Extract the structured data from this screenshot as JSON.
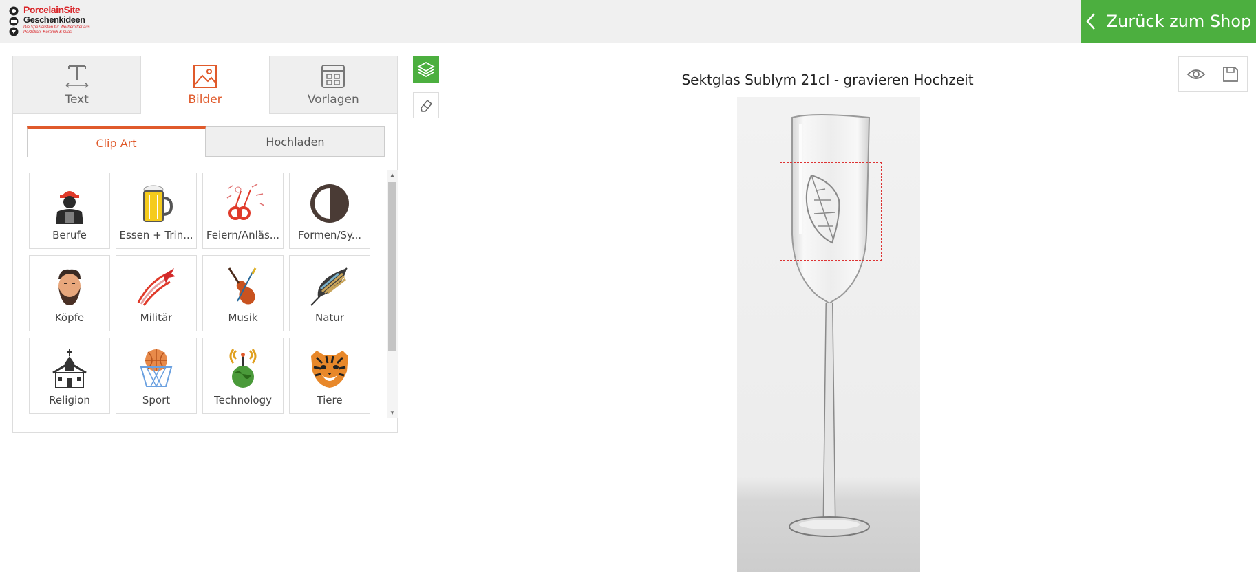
{
  "header": {
    "logo": {
      "line1": "PorcelainSite",
      "line2": "Geschenkideen",
      "tagline": "Die Spezialisten für Werbemittel aus Porzellan, Keramik & Glas"
    },
    "back_label": "Zurück zum Shop",
    "back_icon": "chevron-left-icon",
    "accent": "#4caf3f"
  },
  "tabs": [
    {
      "label": "Text",
      "icon": "text-icon",
      "active": false
    },
    {
      "label": "Bilder",
      "icon": "image-icon",
      "active": true
    },
    {
      "label": "Vorlagen",
      "icon": "template-icon",
      "active": false
    }
  ],
  "subtabs": [
    {
      "label": "Clip Art",
      "active": true
    },
    {
      "label": "Hochladen",
      "active": false
    }
  ],
  "categories": [
    {
      "label": "Berufe",
      "icon": "worker-icon"
    },
    {
      "label": "Essen + Trin...",
      "icon": "beer-icon"
    },
    {
      "label": "Feiern/Anläs...",
      "icon": "celebration-icon"
    },
    {
      "label": "Formen/Sy...",
      "icon": "shape-icon"
    },
    {
      "label": "Köpfe",
      "icon": "head-icon"
    },
    {
      "label": "Militär",
      "icon": "jet-icon"
    },
    {
      "label": "Musik",
      "icon": "violin-icon"
    },
    {
      "label": "Natur",
      "icon": "feather-icon"
    },
    {
      "label": "Religion",
      "icon": "church-icon"
    },
    {
      "label": "Sport",
      "icon": "basketball-icon"
    },
    {
      "label": "Technology",
      "icon": "globe-antenna-icon"
    },
    {
      "label": "Tiere",
      "icon": "tiger-icon"
    }
  ],
  "product": {
    "title": "Sektglas Sublym 21cl - gravieren Hochzeit"
  },
  "tools": {
    "left": [
      "layers-icon",
      "eraser-icon"
    ],
    "right": [
      "eye-icon",
      "save-icon"
    ]
  },
  "colors": {
    "accent_orange": "#e05a2b",
    "green": "#4caf3f",
    "selection": "#dd3333"
  }
}
